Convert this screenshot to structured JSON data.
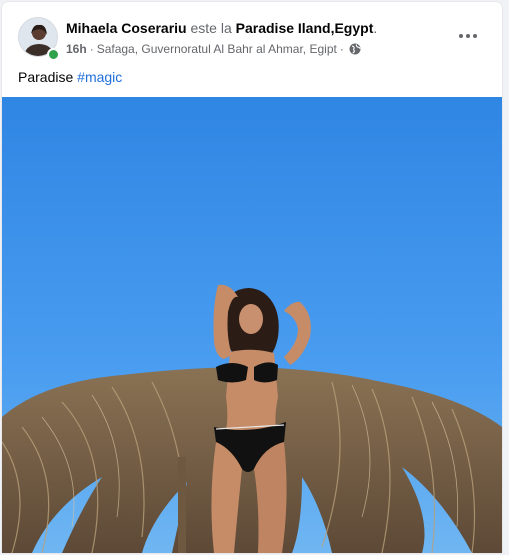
{
  "post": {
    "author": "Mihaela Coserariu",
    "connector": "este la",
    "place": "Paradise Iland,Egypt",
    "period": ".",
    "time": "16h",
    "separator": "·",
    "location": "Safaga, Guvernoratul Al Bahr al Ahmar, Egipt",
    "separator2": "·",
    "privacy_icon": "globe-icon",
    "caption_text": "Paradise ",
    "hashtag": "#magic",
    "more_icon": "more-options-icon"
  },
  "colors": {
    "sky": "#3f94e8",
    "link": "#216fdb",
    "online": "#31a24c",
    "secondary_text": "#65676b"
  }
}
